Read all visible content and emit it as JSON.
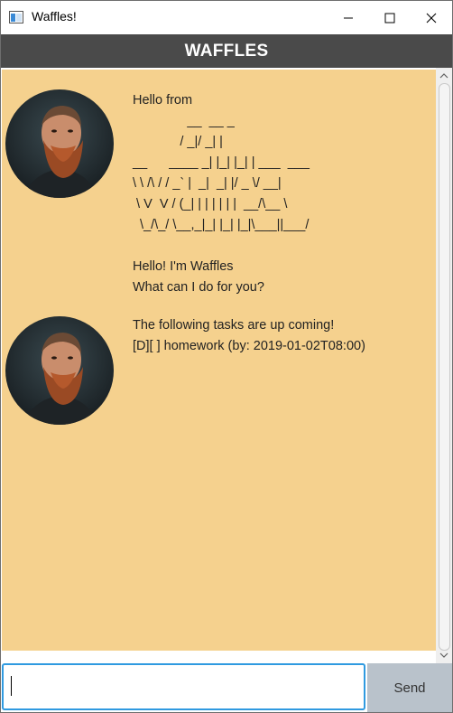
{
  "window": {
    "title": "Waffles!",
    "icon": "app-window-icon"
  },
  "header": {
    "title": "WAFFLES"
  },
  "messages": [
    {
      "avatar": "bearded-man-avatar",
      "text": "Hello from\n               __  __ _\n             / _|/ _| |\n__      ____ _| |_| |_| | ___  ___\n\\ \\ /\\ / / _` |  _|  _| |/ _ \\/ __|\n \\ V  V / (_| | | | | | |  __/\\__ \\\n  \\_/\\_/ \\__,_|_| |_| |_|\\___||___/\n\nHello! I'm Waffles\nWhat can I do for you?"
    },
    {
      "avatar": "bearded-man-avatar",
      "text": "The following tasks are up coming!\n[D][ ] homework (by: 2019-01-02T08:00)"
    }
  ],
  "input": {
    "value": "",
    "placeholder": ""
  },
  "send": {
    "label": "Send"
  },
  "colors": {
    "header_bg": "#4a4a4a",
    "chat_bg": "#f5d18e",
    "input_border": "#2f9ae0",
    "send_bg": "#b9c2cb"
  }
}
